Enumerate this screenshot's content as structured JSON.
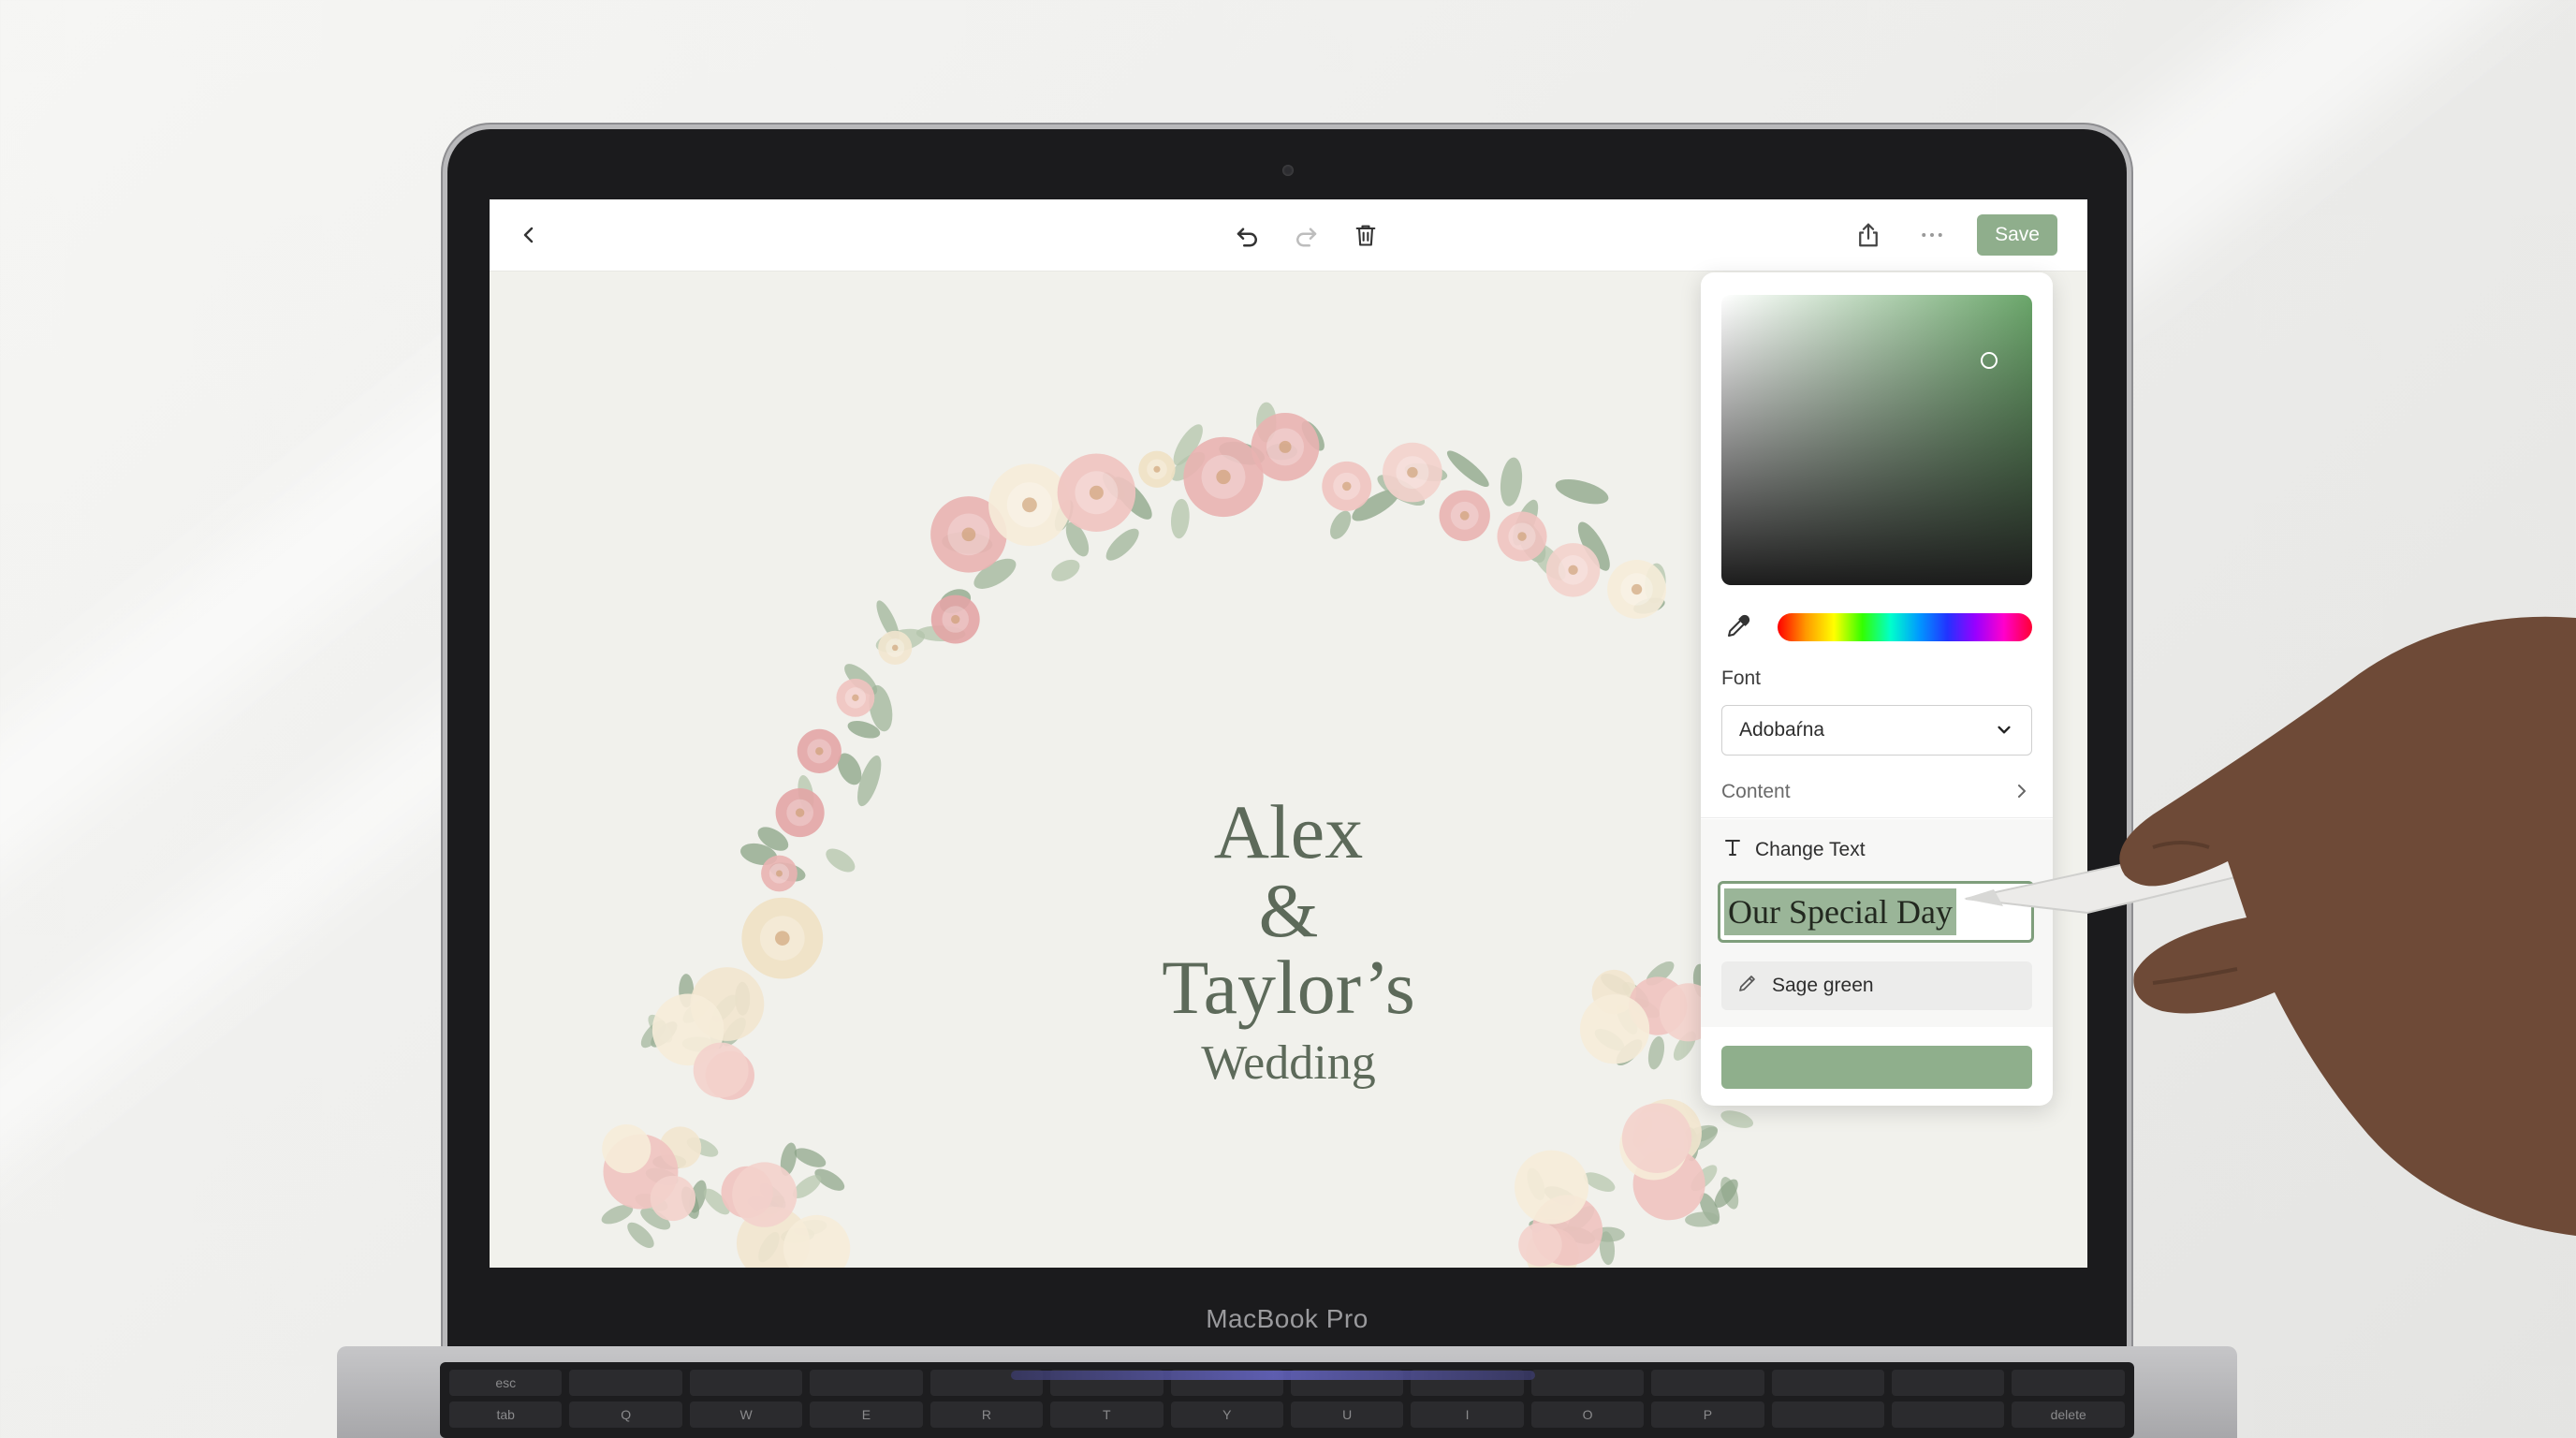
{
  "device": {
    "model_label": "MacBook Pro"
  },
  "toolbar": {
    "back_icon": "chevron-left-icon",
    "undo_icon": "undo-icon",
    "redo_icon": "redo-icon",
    "delete_icon": "trash-icon",
    "share_icon": "share-icon",
    "more_icon": "more-dots-icon",
    "save_label": "Save"
  },
  "invitation": {
    "line1": "Alex",
    "line2": "&",
    "line3": "Taylor’s",
    "line4": "Wedding"
  },
  "panel": {
    "picker_color": "#6aa66a",
    "eyedropper_icon": "eyedropper-icon",
    "font_label": "Font",
    "font_value": "Adobaŕna",
    "content_label": "Content",
    "change_text_label": "Change Text",
    "text_value": "Our Special Day",
    "color_name": "Sage green",
    "accent_color": "#8faf8c"
  },
  "keyboard": {
    "rows": [
      [
        "esc",
        "",
        "",
        "",
        "",
        "",
        "",
        "",
        "",
        "",
        "",
        "",
        "",
        "",
        ""
      ],
      [
        "tab",
        "Q",
        "W",
        "E",
        "R",
        "T",
        "Y",
        "U",
        "I",
        "O",
        "P",
        "",
        "",
        "delete"
      ]
    ]
  }
}
